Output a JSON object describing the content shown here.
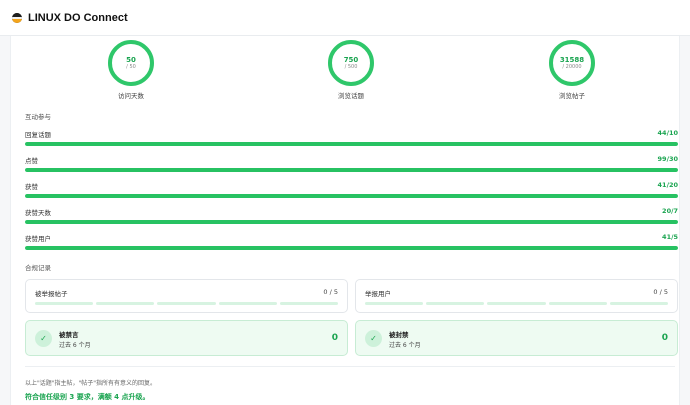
{
  "header": {
    "title": "LINUX DO Connect"
  },
  "circles": [
    {
      "value": "50",
      "goal": "/ 50",
      "label": "访问天数"
    },
    {
      "value": "750",
      "goal": "/ 500",
      "label": "浏览话题"
    },
    {
      "value": "31588",
      "goal": "/ 20000",
      "label": "浏览帖子"
    }
  ],
  "engagement": {
    "title": "互动参与",
    "rows": [
      {
        "label": "回复话题",
        "value": "44/10",
        "progress": 1.0
      },
      {
        "label": "点赞",
        "value": "99/30",
        "progress": 1.0
      },
      {
        "label": "获赞",
        "value": "41/20",
        "progress": 1.0
      },
      {
        "label": "获赞天数",
        "value": "20/7",
        "progress": 1.0
      },
      {
        "label": "获赞用户",
        "value": "41/5",
        "progress": 1.0
      }
    ]
  },
  "compliance": {
    "title": "合规记录",
    "flagged_posts": {
      "label": "被举报帖子",
      "value": "0 / 5"
    },
    "flagging_users": {
      "label": "举报用户",
      "value": "0 / 5"
    },
    "silenced": {
      "title": "被禁言",
      "subtitle": "过去 6 个月",
      "value": "0"
    },
    "suspended": {
      "title": "被封禁",
      "subtitle": "过去 6 个月",
      "value": "0"
    }
  },
  "footer": {
    "note": "以上\"话题\"指主帖，\"帖子\"指所有有意义的回复。",
    "verdict": "符合信任级别 3 要求，满额 4 点升级。"
  },
  "colors": {
    "accent": "#27c262",
    "accent_text": "#1aa450",
    "track": "#dff5e7"
  },
  "icons": {
    "check": "check-icon"
  }
}
